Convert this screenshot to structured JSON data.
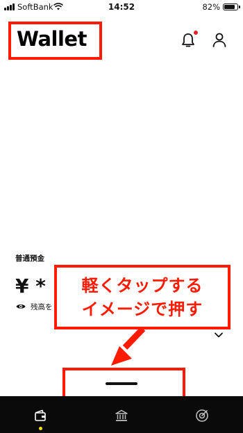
{
  "status_bar": {
    "carrier": "SoftBank",
    "time": "14:52",
    "battery_percent": "82%",
    "battery_level": 0.82,
    "signal_bars": 4
  },
  "header": {
    "title": "Wallet",
    "notification_icon": "bell-icon",
    "notification_badge_color": "#e8202a",
    "profile_icon": "user-icon"
  },
  "account": {
    "label": "普通預金",
    "balance_visible_text": "¥ *",
    "balance_note": "残高を",
    "visibility_icon": "eye-icon",
    "expand_icon": "chevron-down-icon"
  },
  "annotation": {
    "text": "軽くタップするイメージで押す",
    "line1": "軽くタップする",
    "line2": "イメージで押す",
    "color": "#ff1a00"
  },
  "tab_bar": {
    "tabs": [
      {
        "name": "wallet",
        "icon": "wallet-icon",
        "active": true
      },
      {
        "name": "bank",
        "icon": "bank-icon",
        "active": false
      },
      {
        "name": "target",
        "icon": "target-icon",
        "active": false
      }
    ],
    "active_indicator_color": "#f2e000",
    "background": "#0a0a0a"
  }
}
